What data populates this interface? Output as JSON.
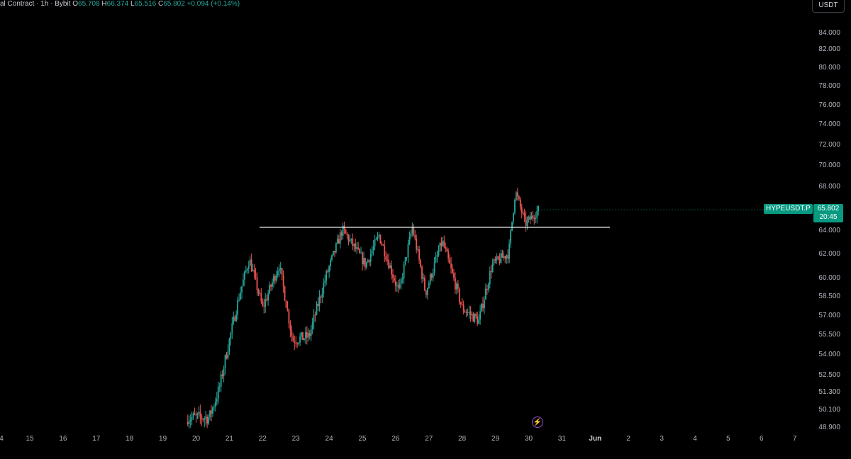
{
  "header": {
    "title": "al Contract · 1h · Bybit",
    "o_label": "O",
    "o": "65.708",
    "h_label": "H",
    "h": "66.374",
    "l_label": "L",
    "l": "65.516",
    "c_label": "C",
    "c": "65.802",
    "change": "+0.094 (+0.14%)"
  },
  "currency_button": "USDT",
  "price_tag": {
    "symbol": "HYPEUSDT.P",
    "price": "65.802",
    "countdown": "20:45"
  },
  "colors": {
    "up": "#26a69a",
    "down": "#ef5350",
    "background": "#000000",
    "tag": "#089981",
    "line": "#ffffff"
  },
  "icons": {
    "event": "lightning-icon"
  },
  "chart_data": {
    "type": "candlestick",
    "symbol": "HYPEUSDT.P",
    "timeframe": "1h",
    "exchange": "Bybit",
    "y_ticks": [
      "84.000",
      "82.000",
      "80.000",
      "78.000",
      "76.000",
      "74.000",
      "72.000",
      "70.000",
      "68.000",
      "64.000",
      "62.000",
      "60.000",
      "58.500",
      "57.000",
      "55.500",
      "54.000",
      "52.500",
      "51.300",
      "50.100",
      "48.900"
    ],
    "x_ticks": [
      "4",
      "15",
      "16",
      "17",
      "18",
      "19",
      "20",
      "21",
      "22",
      "23",
      "24",
      "25",
      "26",
      "27",
      "28",
      "29",
      "30",
      "31",
      "Jun",
      "2",
      "3",
      "4",
      "5",
      "6",
      "7"
    ],
    "horizontal_line": {
      "price": 64.2,
      "from": "21.9",
      "to": "31.5"
    },
    "close_approx": [
      {
        "day": 20.4,
        "price": 49.5
      },
      {
        "day": 20.7,
        "price": 51.5
      },
      {
        "day": 21.0,
        "price": 55.0
      },
      {
        "day": 21.3,
        "price": 58.5
      },
      {
        "day": 21.6,
        "price": 61.5
      },
      {
        "day": 22.0,
        "price": 57.5
      },
      {
        "day": 22.5,
        "price": 61.0
      },
      {
        "day": 22.9,
        "price": 55.0
      },
      {
        "day": 23.4,
        "price": 55.3
      },
      {
        "day": 23.9,
        "price": 60.0
      },
      {
        "day": 24.4,
        "price": 64.0
      },
      {
        "day": 25.1,
        "price": 61.0
      },
      {
        "day": 25.5,
        "price": 63.5
      },
      {
        "day": 26.1,
        "price": 58.7
      },
      {
        "day": 26.5,
        "price": 64.2
      },
      {
        "day": 26.9,
        "price": 58.7
      },
      {
        "day": 27.4,
        "price": 63.0
      },
      {
        "day": 28.0,
        "price": 57.5
      },
      {
        "day": 28.5,
        "price": 56.5
      },
      {
        "day": 28.9,
        "price": 61.0
      },
      {
        "day": 29.4,
        "price": 62.0
      },
      {
        "day": 29.6,
        "price": 67.5
      },
      {
        "day": 29.9,
        "price": 64.5
      },
      {
        "day": 30.3,
        "price": 65.8
      }
    ]
  }
}
